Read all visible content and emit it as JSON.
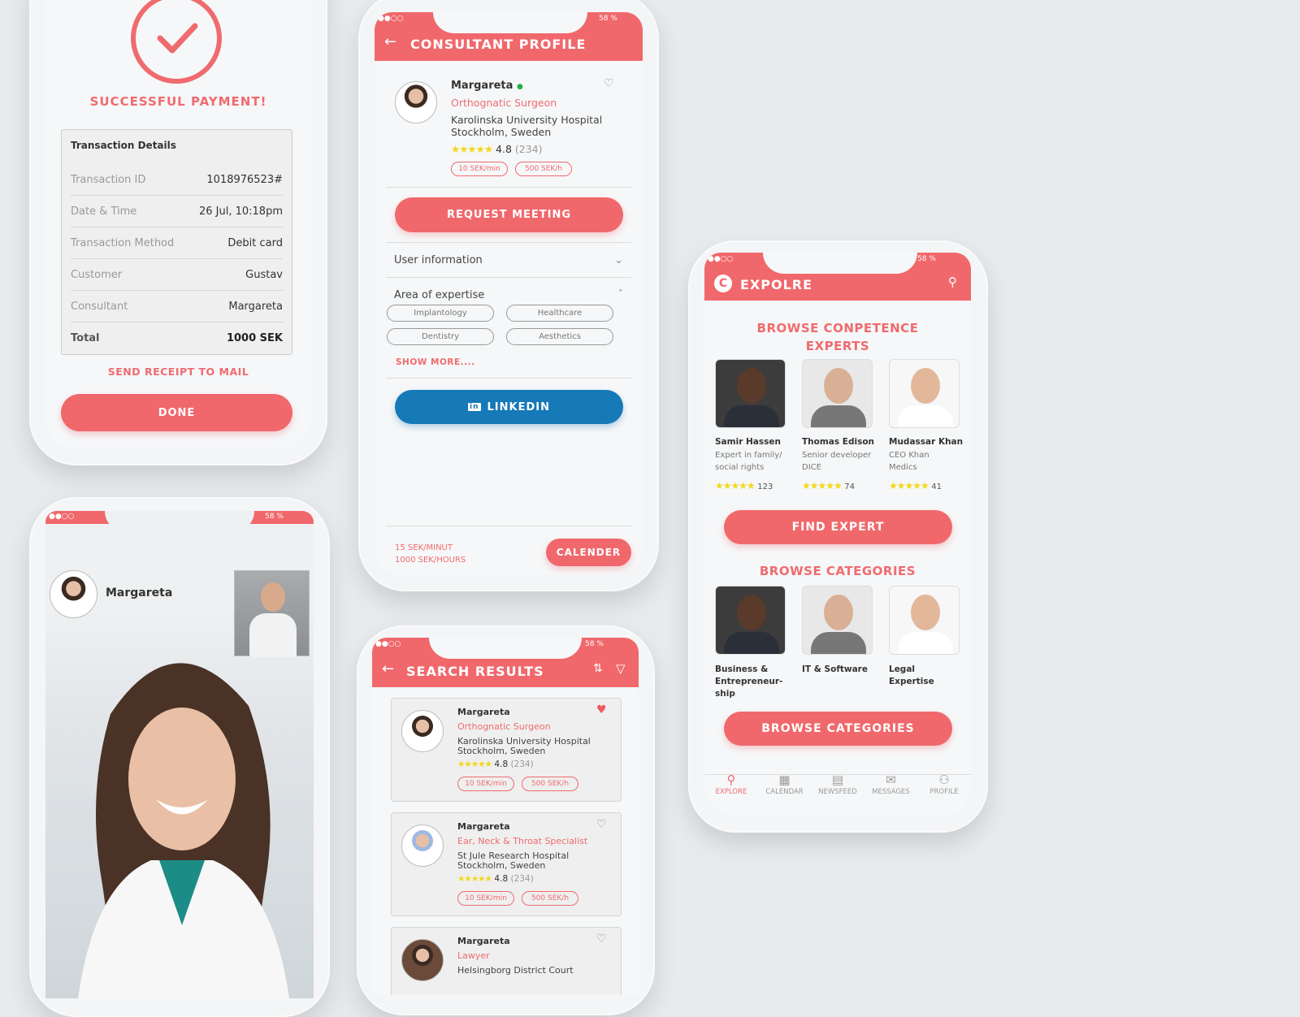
{
  "colors": {
    "accent": "#f0686c",
    "linkedin": "#1679b8",
    "star": "#f3d716",
    "online": "#22b14c"
  },
  "status": {
    "signal": "●●○○",
    "battery": "58 %"
  },
  "payment": {
    "title": "SUCCESSFUL PAYMENT!",
    "details_title": "Transaction Details",
    "rows": [
      {
        "label": "Transaction ID",
        "value": "1018976523#"
      },
      {
        "label": "Date & Time",
        "value": "26 Jul, 10:18pm"
      },
      {
        "label": "Transaction Method",
        "value": "Debit card"
      },
      {
        "label": "Customer",
        "value": "Gustav"
      },
      {
        "label": "Consultant",
        "value": "Margareta"
      }
    ],
    "total_label": "Total",
    "total_value": "1000 SEK",
    "send_receipt": "SEND RECEIPT TO MAIL",
    "done": "DONE"
  },
  "profile": {
    "title": "CONSULTANT PROFILE",
    "name": "Margareta",
    "specialty": "Orthognatic Surgeon",
    "hospital": "Karolinska University Hospital",
    "city": "Stockholm, Sweden",
    "stars": "★★★★★",
    "rating": "4.8",
    "reviews": "(234)",
    "price_min": "10 SEK/min",
    "price_hour": "500 SEK/h",
    "request": "REQUEST MEETING",
    "user_info": "User information",
    "expertise": "Area of expertise",
    "chips": [
      "Implantology",
      "Healthcare",
      "Dentistry",
      "Aesthetics"
    ],
    "show_more": "SHOW MORE....",
    "linkedin": "LINKEDIN",
    "rate1": "15 SEK/MINUT",
    "rate2": "1000 SEK/HOURS",
    "calender": "CALENDER"
  },
  "video": {
    "name": "Margareta"
  },
  "search": {
    "title": "SEARCH RESULTS",
    "results": [
      {
        "name": "Margareta",
        "specialty": "Orthognatic Surgeon",
        "hospital": "Karolinska University Hospital",
        "city": "Stockholm, Sweden",
        "stars": "★★★★★",
        "rating": "4.8",
        "reviews": "(234)",
        "price_min": "10 SEK/min",
        "price_hour": "500 SEK/h",
        "favorite": true
      },
      {
        "name": "Margareta",
        "specialty": "Ear, Neck & Throat Specialist",
        "hospital": "St Jule Research Hospital",
        "city": "Stockholm, Sweden",
        "stars": "★★★★★",
        "rating": "4.8",
        "reviews": "(234)",
        "price_min": "10 SEK/min",
        "price_hour": "500 SEK/h",
        "favorite": false
      },
      {
        "name": "Margareta",
        "specialty": "Lawyer",
        "hospital": "Helsingborg District Court",
        "favorite": false
      }
    ]
  },
  "explore": {
    "title": "EXPOLRE",
    "section1": "BROWSE CONPETENCE EXPERTS",
    "experts": [
      {
        "name": "Samir Hassen",
        "desc1": "Expert in family/",
        "desc2": "social rights",
        "stars": "★★★★★",
        "count": "123"
      },
      {
        "name": "Thomas Edison",
        "desc1": "Senior developer",
        "desc2": "DICE",
        "stars": "★★★★★",
        "count": "74"
      },
      {
        "name": "Mudassar Khan",
        "desc1": "CEO Khan",
        "desc2": "Medics",
        "stars": "★★★★★",
        "count": "41"
      }
    ],
    "find_expert": "FIND EXPERT",
    "section2": "BROWSE CATEGORIES",
    "categories": [
      {
        "label": "Business & Entrepreneur-ship"
      },
      {
        "label": "IT & Software"
      },
      {
        "label": "Legal Expertise"
      }
    ],
    "browse_button": "BROWSE CATEGORIES",
    "nav": [
      {
        "label": "EXPLORE",
        "icon": "search-icon",
        "active": true
      },
      {
        "label": "CALENDAR",
        "icon": "calendar-icon"
      },
      {
        "label": "NEWSFEED",
        "icon": "newsfeed-icon"
      },
      {
        "label": "MESSAGES",
        "icon": "envelope-icon"
      },
      {
        "label": "PROFILE",
        "icon": "person-icon"
      }
    ]
  }
}
